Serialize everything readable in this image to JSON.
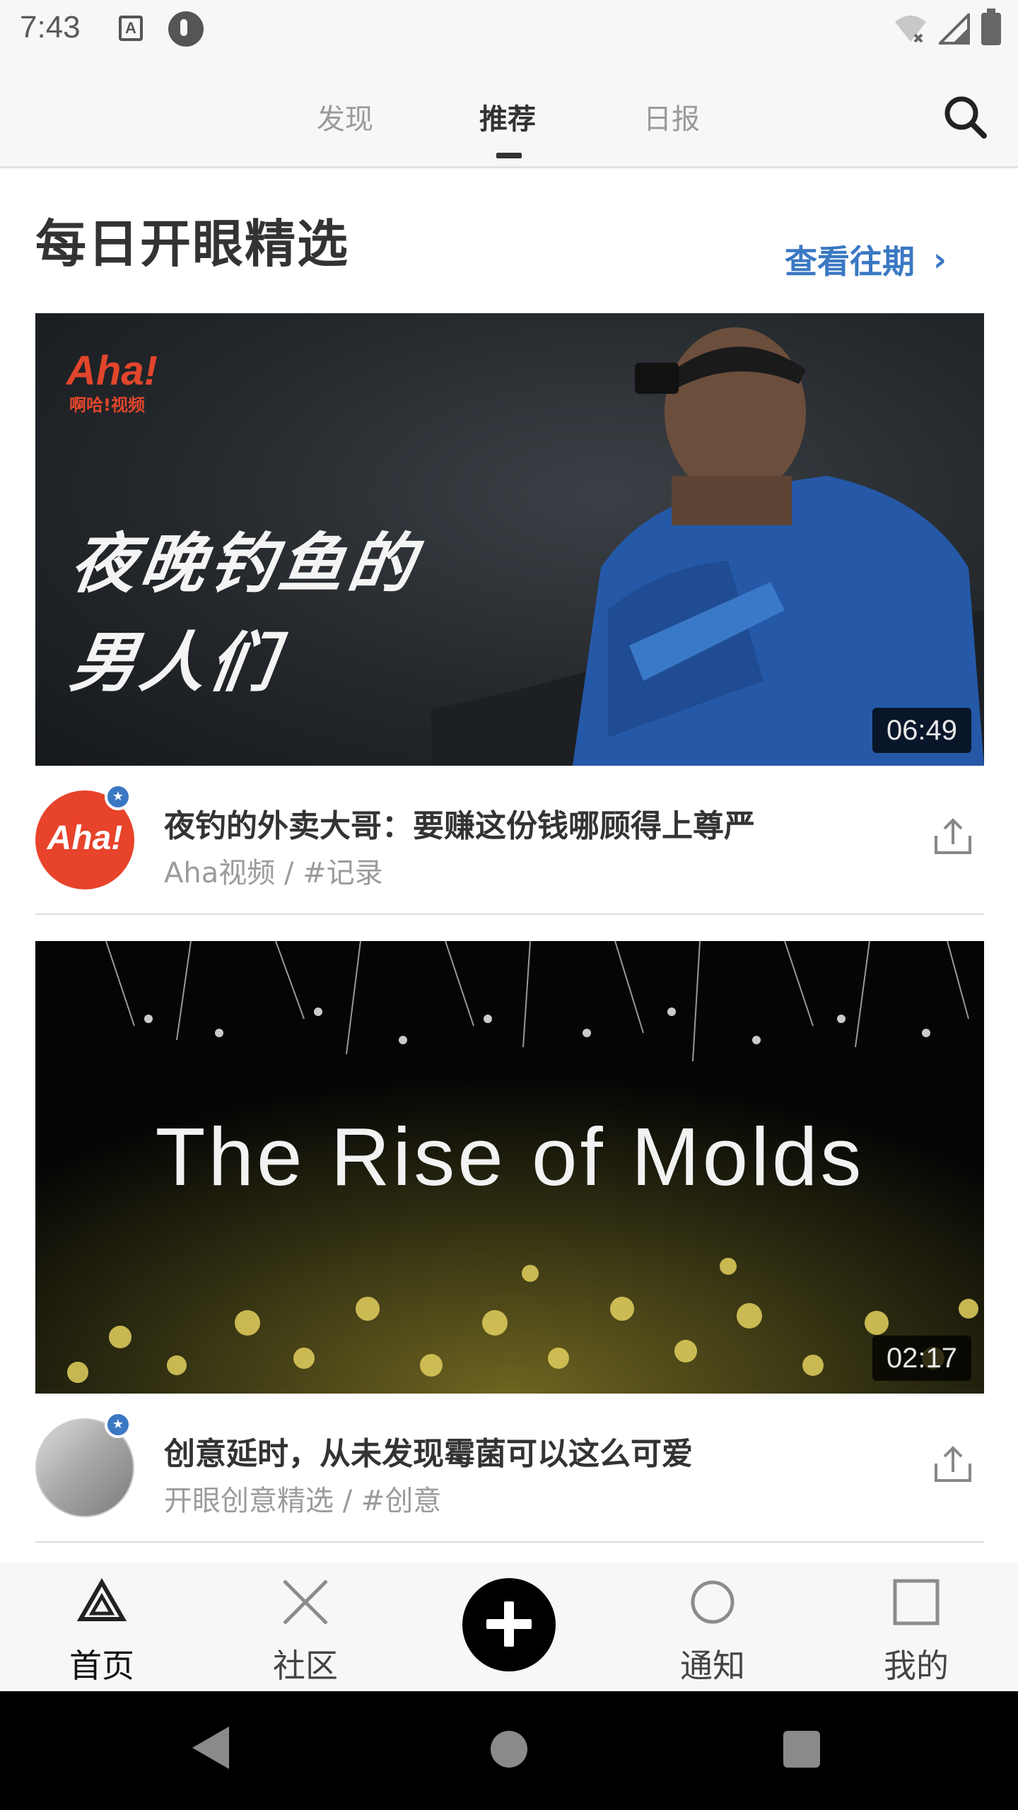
{
  "status_bar": {
    "time": "7:43",
    "left_icons": [
      "a-notification-icon",
      "pocket-icon"
    ],
    "right_icons": [
      "wifi-off-icon",
      "signal-icon",
      "battery-icon"
    ]
  },
  "top_nav": {
    "tabs": [
      {
        "label": "发现",
        "active": false
      },
      {
        "label": "推荐",
        "active": true
      },
      {
        "label": "日报",
        "active": false
      }
    ],
    "search_icon": "search-icon"
  },
  "section": {
    "title": "每日开眼精选",
    "view_past": "查看往期",
    "view_past_color": "#3a78c3"
  },
  "videos": [
    {
      "thumb_logo": "Aha!",
      "thumb_logo_sub": "啊哈!视频",
      "thumb_line1": "夜晚钓鱼的",
      "thumb_line2": "男人们",
      "duration": "06:49",
      "title": "夜钓的外卖大哥：要赚这份钱哪顾得上尊严",
      "meta": "Aha视频  /  #记录",
      "avatar_text": "Aha!"
    },
    {
      "thumb_title": "The Rise of Molds",
      "duration": "02:17",
      "title": "创意延时，从未发现霉菌可以这么可爱",
      "meta": "开眼创意精选  /  #创意"
    }
  ],
  "bottom_nav": {
    "items": [
      {
        "label": "首页",
        "icon": "triangle-icon",
        "active": true
      },
      {
        "label": "社区",
        "icon": "cross-icon",
        "active": false
      },
      {
        "label": "",
        "icon": "add-icon",
        "active": false
      },
      {
        "label": "通知",
        "icon": "circle-icon",
        "active": false
      },
      {
        "label": "我的",
        "icon": "square-icon",
        "active": false
      }
    ]
  },
  "system_nav": [
    "back-icon",
    "home-icon",
    "recents-icon"
  ]
}
